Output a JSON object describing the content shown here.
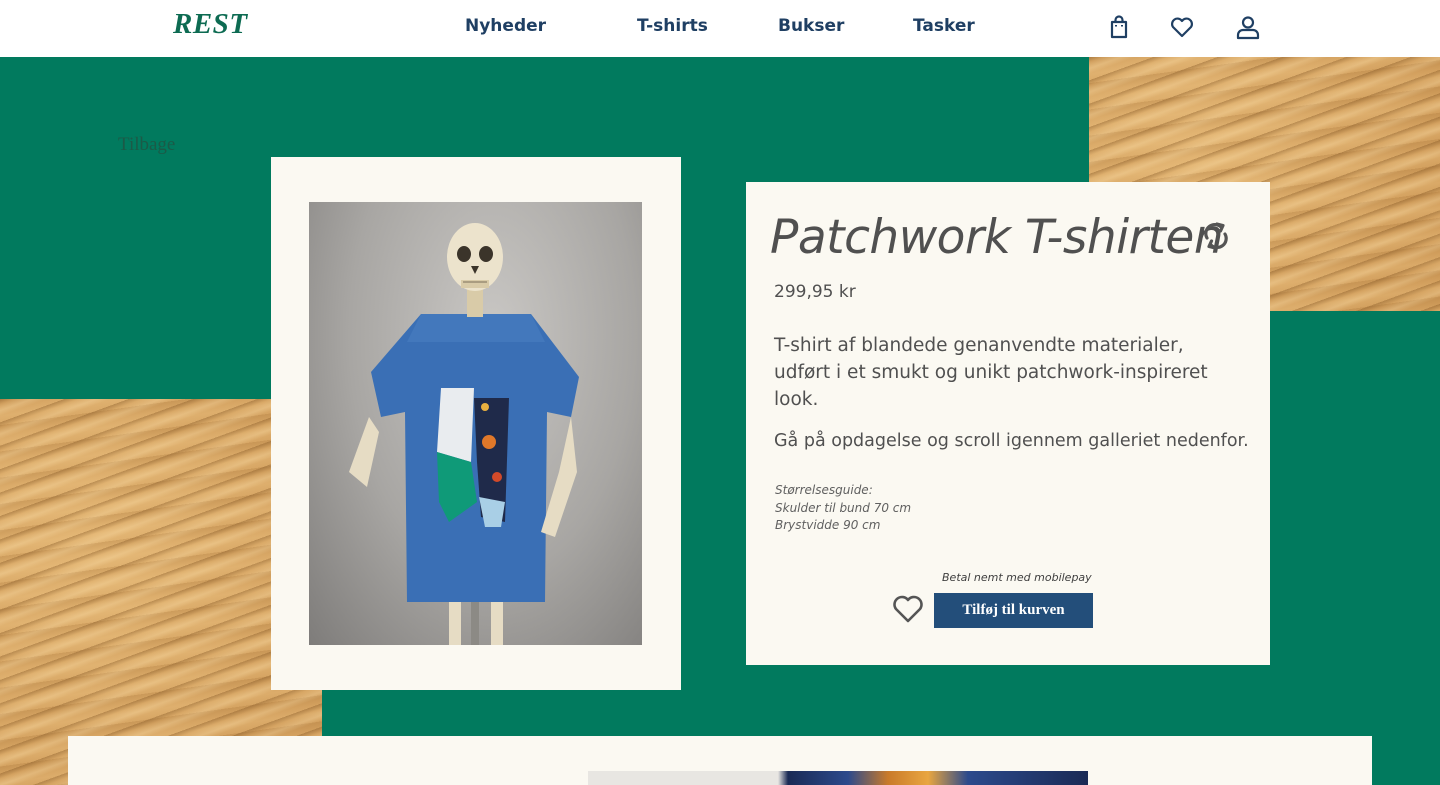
{
  "header": {
    "logo": "REST",
    "nav": [
      {
        "label": "Nyheder"
      },
      {
        "label": "T-shirts"
      },
      {
        "label": "Bukser"
      },
      {
        "label": "Tasker"
      }
    ],
    "icons": [
      "shopping-bag-icon",
      "heart-icon",
      "user-icon"
    ]
  },
  "back_link": "Tilbage",
  "product": {
    "title": "Patchwork T-shirten",
    "price": "299,95 kr",
    "description": "T-shirt af blandede genanvendte materialer, udført i et smukt og unikt patchwork-inspireret look.",
    "explore_text": "Gå på opdagelse og scroll igennem galleriet nedenfor.",
    "size_guide": {
      "heading": "Størrelsesguide:",
      "lines": [
        "Skulder til bund 70 cm",
        "Brystvidde 90 cm"
      ]
    },
    "payment_note": "Betal nemt med mobilepay",
    "add_to_cart_label": "Tilføj til kurven"
  },
  "colors": {
    "brand_green": "#017a5e",
    "nav_text": "#1f3f63",
    "button_bg": "#234e7a",
    "card_bg": "#fbf9f2"
  }
}
